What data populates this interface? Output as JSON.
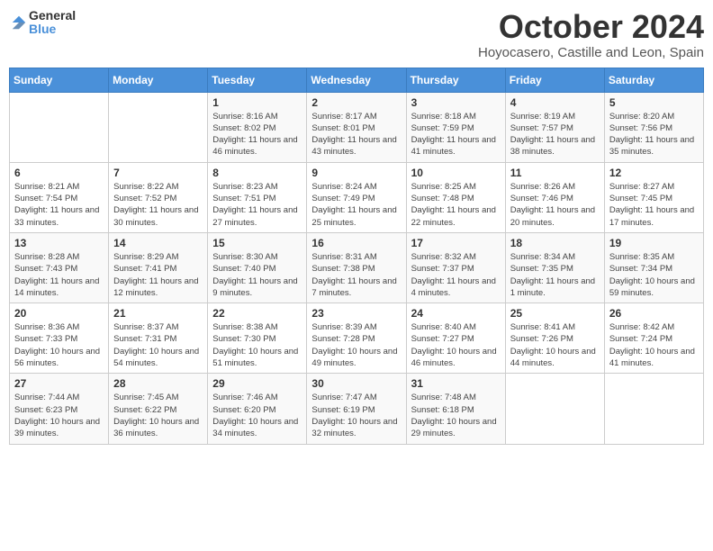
{
  "logo": {
    "general": "General",
    "blue": "Blue"
  },
  "title": "October 2024",
  "location": "Hoyocasero, Castille and Leon, Spain",
  "headers": [
    "Sunday",
    "Monday",
    "Tuesday",
    "Wednesday",
    "Thursday",
    "Friday",
    "Saturday"
  ],
  "weeks": [
    [
      {
        "day": "",
        "detail": ""
      },
      {
        "day": "",
        "detail": ""
      },
      {
        "day": "1",
        "detail": "Sunrise: 8:16 AM\nSunset: 8:02 PM\nDaylight: 11 hours and 46 minutes."
      },
      {
        "day": "2",
        "detail": "Sunrise: 8:17 AM\nSunset: 8:01 PM\nDaylight: 11 hours and 43 minutes."
      },
      {
        "day": "3",
        "detail": "Sunrise: 8:18 AM\nSunset: 7:59 PM\nDaylight: 11 hours and 41 minutes."
      },
      {
        "day": "4",
        "detail": "Sunrise: 8:19 AM\nSunset: 7:57 PM\nDaylight: 11 hours and 38 minutes."
      },
      {
        "day": "5",
        "detail": "Sunrise: 8:20 AM\nSunset: 7:56 PM\nDaylight: 11 hours and 35 minutes."
      }
    ],
    [
      {
        "day": "6",
        "detail": "Sunrise: 8:21 AM\nSunset: 7:54 PM\nDaylight: 11 hours and 33 minutes."
      },
      {
        "day": "7",
        "detail": "Sunrise: 8:22 AM\nSunset: 7:52 PM\nDaylight: 11 hours and 30 minutes."
      },
      {
        "day": "8",
        "detail": "Sunrise: 8:23 AM\nSunset: 7:51 PM\nDaylight: 11 hours and 27 minutes."
      },
      {
        "day": "9",
        "detail": "Sunrise: 8:24 AM\nSunset: 7:49 PM\nDaylight: 11 hours and 25 minutes."
      },
      {
        "day": "10",
        "detail": "Sunrise: 8:25 AM\nSunset: 7:48 PM\nDaylight: 11 hours and 22 minutes."
      },
      {
        "day": "11",
        "detail": "Sunrise: 8:26 AM\nSunset: 7:46 PM\nDaylight: 11 hours and 20 minutes."
      },
      {
        "day": "12",
        "detail": "Sunrise: 8:27 AM\nSunset: 7:45 PM\nDaylight: 11 hours and 17 minutes."
      }
    ],
    [
      {
        "day": "13",
        "detail": "Sunrise: 8:28 AM\nSunset: 7:43 PM\nDaylight: 11 hours and 14 minutes."
      },
      {
        "day": "14",
        "detail": "Sunrise: 8:29 AM\nSunset: 7:41 PM\nDaylight: 11 hours and 12 minutes."
      },
      {
        "day": "15",
        "detail": "Sunrise: 8:30 AM\nSunset: 7:40 PM\nDaylight: 11 hours and 9 minutes."
      },
      {
        "day": "16",
        "detail": "Sunrise: 8:31 AM\nSunset: 7:38 PM\nDaylight: 11 hours and 7 minutes."
      },
      {
        "day": "17",
        "detail": "Sunrise: 8:32 AM\nSunset: 7:37 PM\nDaylight: 11 hours and 4 minutes."
      },
      {
        "day": "18",
        "detail": "Sunrise: 8:34 AM\nSunset: 7:35 PM\nDaylight: 11 hours and 1 minute."
      },
      {
        "day": "19",
        "detail": "Sunrise: 8:35 AM\nSunset: 7:34 PM\nDaylight: 10 hours and 59 minutes."
      }
    ],
    [
      {
        "day": "20",
        "detail": "Sunrise: 8:36 AM\nSunset: 7:33 PM\nDaylight: 10 hours and 56 minutes."
      },
      {
        "day": "21",
        "detail": "Sunrise: 8:37 AM\nSunset: 7:31 PM\nDaylight: 10 hours and 54 minutes."
      },
      {
        "day": "22",
        "detail": "Sunrise: 8:38 AM\nSunset: 7:30 PM\nDaylight: 10 hours and 51 minutes."
      },
      {
        "day": "23",
        "detail": "Sunrise: 8:39 AM\nSunset: 7:28 PM\nDaylight: 10 hours and 49 minutes."
      },
      {
        "day": "24",
        "detail": "Sunrise: 8:40 AM\nSunset: 7:27 PM\nDaylight: 10 hours and 46 minutes."
      },
      {
        "day": "25",
        "detail": "Sunrise: 8:41 AM\nSunset: 7:26 PM\nDaylight: 10 hours and 44 minutes."
      },
      {
        "day": "26",
        "detail": "Sunrise: 8:42 AM\nSunset: 7:24 PM\nDaylight: 10 hours and 41 minutes."
      }
    ],
    [
      {
        "day": "27",
        "detail": "Sunrise: 7:44 AM\nSunset: 6:23 PM\nDaylight: 10 hours and 39 minutes."
      },
      {
        "day": "28",
        "detail": "Sunrise: 7:45 AM\nSunset: 6:22 PM\nDaylight: 10 hours and 36 minutes."
      },
      {
        "day": "29",
        "detail": "Sunrise: 7:46 AM\nSunset: 6:20 PM\nDaylight: 10 hours and 34 minutes."
      },
      {
        "day": "30",
        "detail": "Sunrise: 7:47 AM\nSunset: 6:19 PM\nDaylight: 10 hours and 32 minutes."
      },
      {
        "day": "31",
        "detail": "Sunrise: 7:48 AM\nSunset: 6:18 PM\nDaylight: 10 hours and 29 minutes."
      },
      {
        "day": "",
        "detail": ""
      },
      {
        "day": "",
        "detail": ""
      }
    ]
  ]
}
